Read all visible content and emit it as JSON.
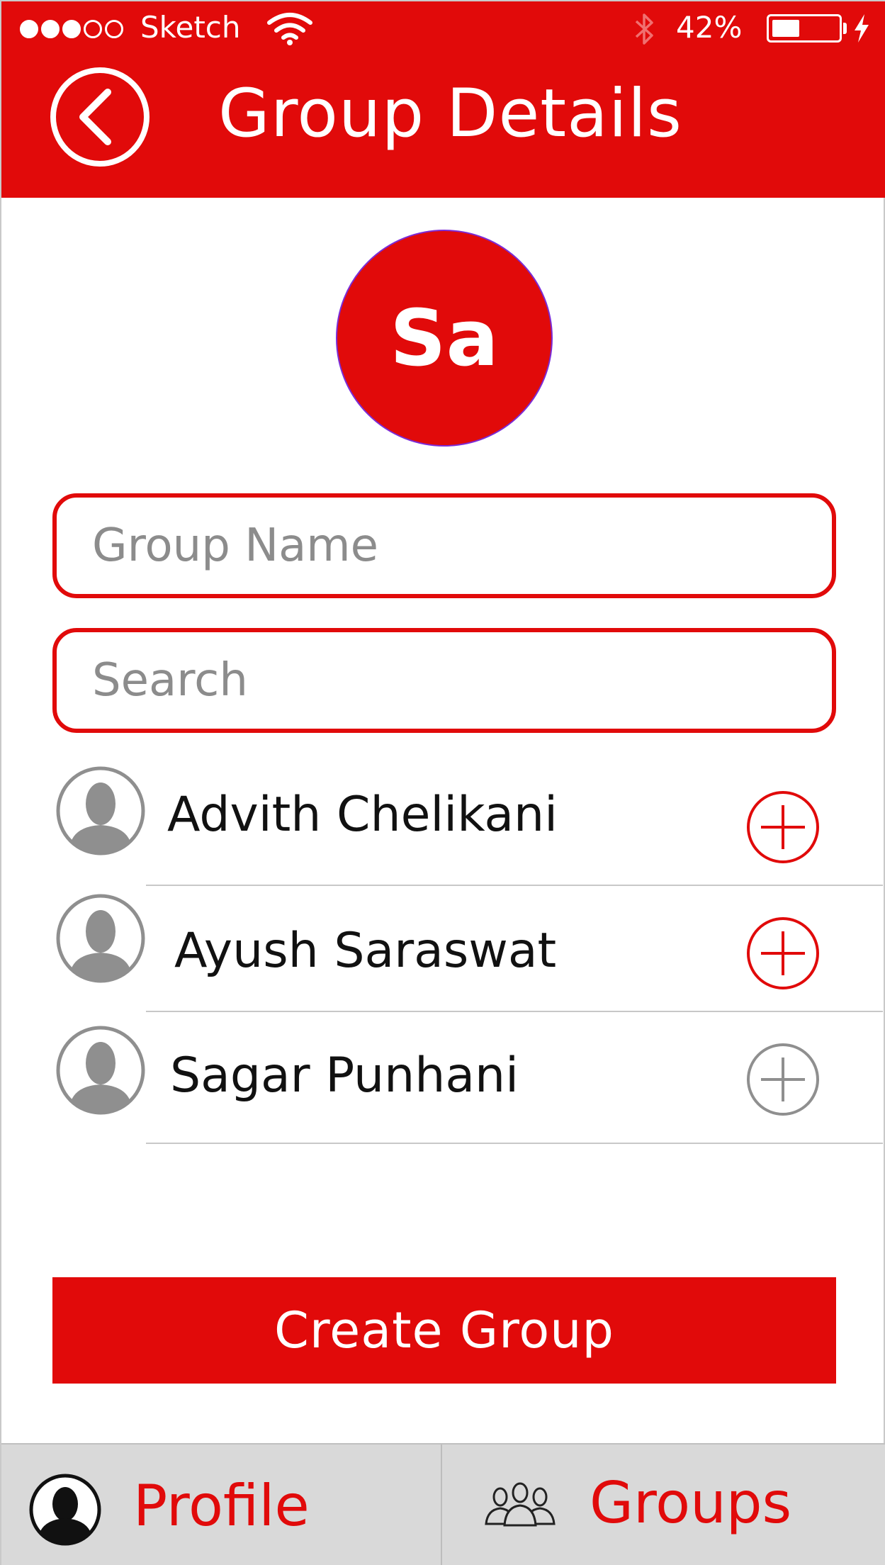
{
  "status_bar": {
    "carrier": "Sketch",
    "battery_percent": "42%",
    "battery_level": 0.42,
    "signal_bars_filled": 3,
    "signal_bars_total": 5
  },
  "header": {
    "title": "Group Details",
    "back_icon": "chevron-left-circle-icon",
    "background_color": "#e10a0a"
  },
  "group_avatar": {
    "initials": "Sa"
  },
  "form": {
    "group_name": {
      "value": "",
      "placeholder": "Group Name"
    },
    "search": {
      "value": "",
      "placeholder": "Search"
    }
  },
  "contacts": [
    {
      "name": "Advith Chelikani",
      "add_state": "active"
    },
    {
      "name": "Ayush Saraswat",
      "add_state": "active"
    },
    {
      "name": "Sagar Punhani",
      "add_state": "inactive"
    }
  ],
  "actions": {
    "create_label": "Create Group"
  },
  "tabbar": {
    "profile_label": "Profile",
    "groups_label": "Groups"
  },
  "colors": {
    "accent": "#e10a0a",
    "inactive": "#8f8f8f",
    "tabbar_bg": "#d9d9d9"
  }
}
